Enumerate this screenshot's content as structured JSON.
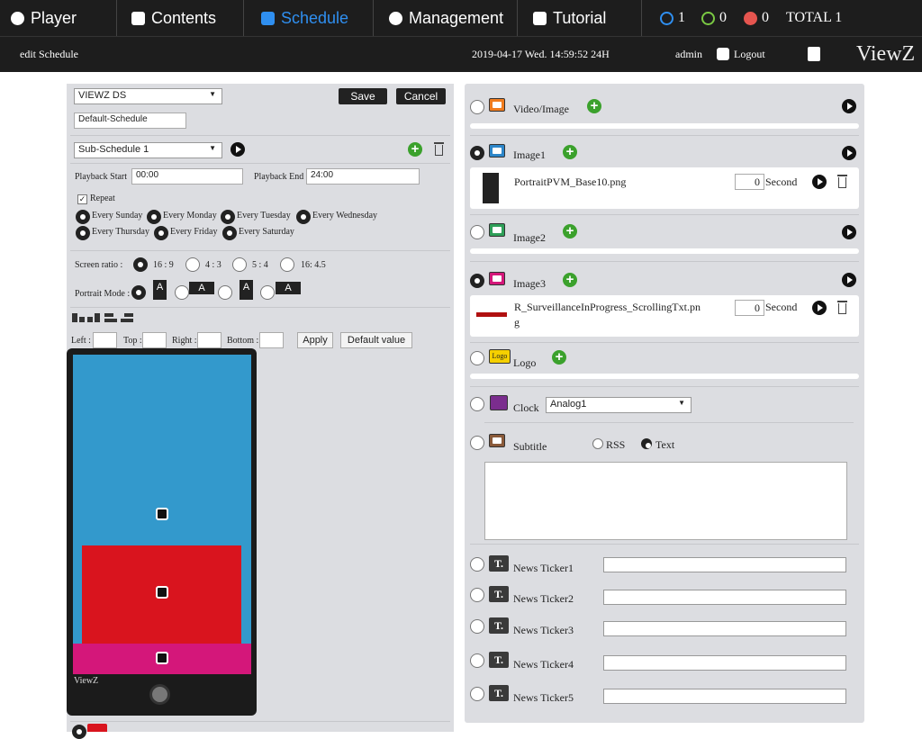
{
  "nav": {
    "player": "Player",
    "contents": "Contents",
    "schedule": "Schedule",
    "management": "Management",
    "tutorial": "Tutorial",
    "status_blue": "1",
    "status_green": "0",
    "status_red": "0",
    "total": "TOTAL 1"
  },
  "subbar": {
    "page_title": "edit Schedule",
    "datetime": "2019-04-17  Wed.  14:59:52  24H",
    "user": "admin",
    "logout": "Logout",
    "brand": "ViewZ"
  },
  "left": {
    "player_select": "VIEWZ DS",
    "save": "Save",
    "cancel": "Cancel",
    "schedule_name": "Default-Schedule",
    "subschedule_select": "Sub-Schedule 1",
    "playback_start_label": "Playback Start",
    "playback_start": "00:00",
    "playback_end_label": "Playback End",
    "playback_end": "24:00",
    "repeat_label": "Repeat",
    "days": [
      "Every Sunday",
      "Every Monday",
      "Every Tuesday",
      "Every Wednesday",
      "Every Thursday",
      "Every Friday",
      "Every Saturday"
    ],
    "screen_ratio_label": "Screen ratio :",
    "ratios": [
      "16 : 9",
      "4 : 3",
      "5 : 4",
      "16: 4.5"
    ],
    "portrait_label": "Portrait Mode :",
    "left_label": "Left :",
    "top_label": "Top :",
    "right_label": "Right :",
    "bottom_label": "Bottom :",
    "apply": "Apply",
    "default_value": "Default value",
    "preview_brand": "ViewZ",
    "icon_letter": "A"
  },
  "right": {
    "video_image": "Video/Image",
    "image1": "Image1",
    "image1_file": "PortraitPVM_Base10.png",
    "image1_seconds": "0",
    "second_label": "Second",
    "image2": "Image2",
    "image3": "Image3",
    "image3_file_line1": "R_SurveillanceInProgress_ScrollingTxt.pn",
    "image3_file_line2": "g",
    "image3_seconds": "0",
    "logo": "Logo",
    "logo_icon_text": "Logo",
    "clock": "Clock",
    "clock_select": "Analog1",
    "subtitle": "Subtitle",
    "rss": "RSS",
    "text": "Text",
    "ticker_icon": "T.",
    "tickers": [
      "News Ticker1",
      "News Ticker2",
      "News Ticker3",
      "News Ticker4",
      "News Ticker5"
    ]
  },
  "colors": {
    "nav_bg": "#1d1d1d",
    "active": "#2f8ff0",
    "preview_blue": "#3399cc",
    "preview_red": "#d9141e",
    "preview_magenta": "#d4177a"
  }
}
